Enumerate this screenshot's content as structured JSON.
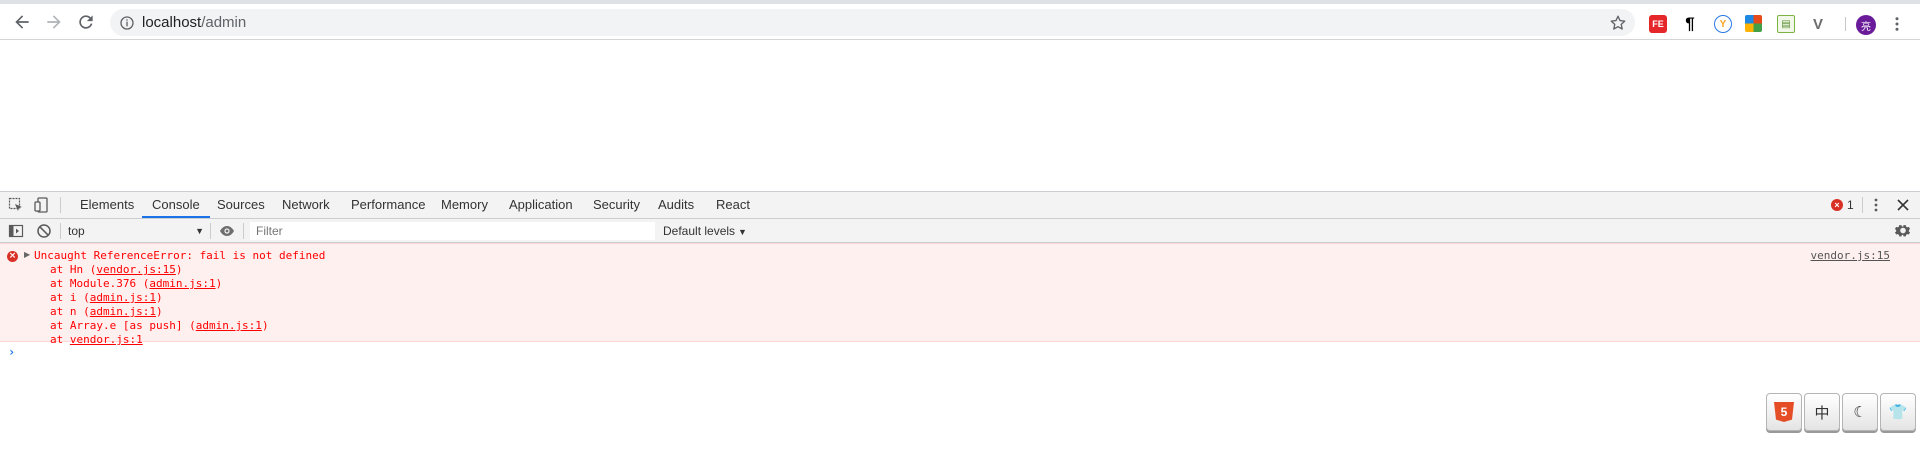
{
  "browser": {
    "url_host": "localhost",
    "url_path": "/admin",
    "avatar_initial": "亮",
    "extensions": [
      "FE",
      "¶",
      "Y",
      "",
      "",
      "V"
    ],
    "icons": {
      "back": "arrow-left-icon",
      "forward": "arrow-right-icon",
      "reload": "reload-icon",
      "info": "info-icon",
      "bookmark": "star-icon",
      "menu": "kebab-menu-icon"
    }
  },
  "devtools": {
    "tabs": [
      "Elements",
      "Console",
      "Sources",
      "Network",
      "Performance",
      "Memory",
      "Application",
      "Security",
      "Audits",
      "React"
    ],
    "active_tab": "Console",
    "error_count": "1",
    "accent": "#1a73e8",
    "console_toolbar": {
      "context": "top",
      "filter_placeholder": "Filter",
      "levels": "Default levels"
    },
    "error": {
      "message": "Uncaught ReferenceError: fail is not defined",
      "source": "vendor.js:15",
      "color": "#ff0000",
      "background": "#fff0f0",
      "stack": [
        {
          "prefix": "at Hn (",
          "link": "vendor.js:15",
          "suffix": ")"
        },
        {
          "prefix": "at Module.376 (",
          "link": "admin.js:1",
          "suffix": ")"
        },
        {
          "prefix": "at i (",
          "link": "admin.js:1",
          "suffix": ")"
        },
        {
          "prefix": "at n (",
          "link": "admin.js:1",
          "suffix": ")"
        },
        {
          "prefix": "at Array.e [as push] (",
          "link": "admin.js:1",
          "suffix": ")"
        },
        {
          "prefix": "at ",
          "link": "vendor.js:1",
          "suffix": ""
        }
      ]
    },
    "prompt": "›"
  },
  "widget": {
    "buttons": [
      {
        "name": "html5-icon",
        "label": "5"
      },
      {
        "name": "chinese-input-icon",
        "label": "中"
      },
      {
        "name": "moon-icon",
        "label": "☾"
      },
      {
        "name": "shirt-icon",
        "label": "👕"
      }
    ]
  }
}
